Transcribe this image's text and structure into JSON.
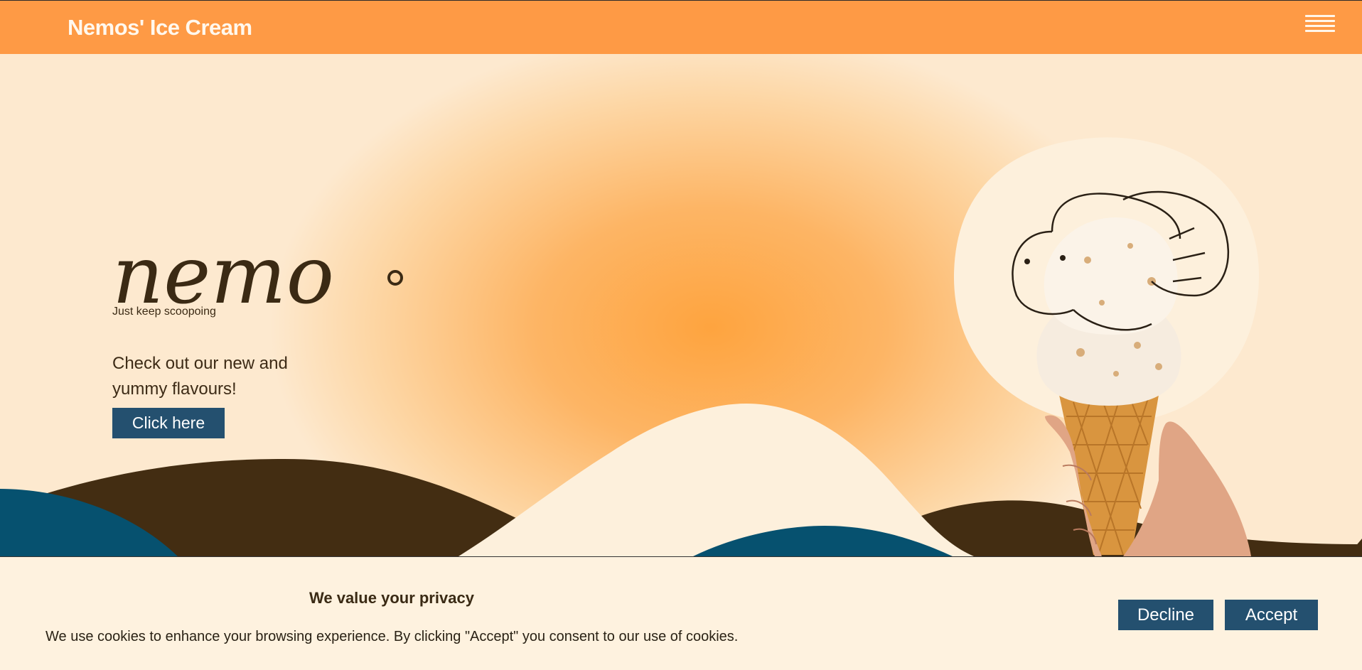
{
  "header": {
    "brand": "Nemos' Ice Cream",
    "menu_icon": "hamburger-menu-icon"
  },
  "hero": {
    "logo_text": "nemo",
    "tagline": "Just keep scoopoing",
    "promo_text": "Check out our new and yummy flavours!",
    "cta_label": "Click here",
    "image_subject": "ice cream cone held in hand with elephant doodle"
  },
  "cookie_banner": {
    "title": "We value your privacy",
    "text": "We use cookies to enhance your browsing experience. By clicking \"Accept\" you consent to our use of cookies.",
    "decline_label": "Decline",
    "accept_label": "Accept"
  },
  "colors": {
    "header": "#fe9a45",
    "accent_blue": "#24506f",
    "dark_brown": "#432d12",
    "wave_blue": "#06516f",
    "cream": "#fdf0dc"
  }
}
